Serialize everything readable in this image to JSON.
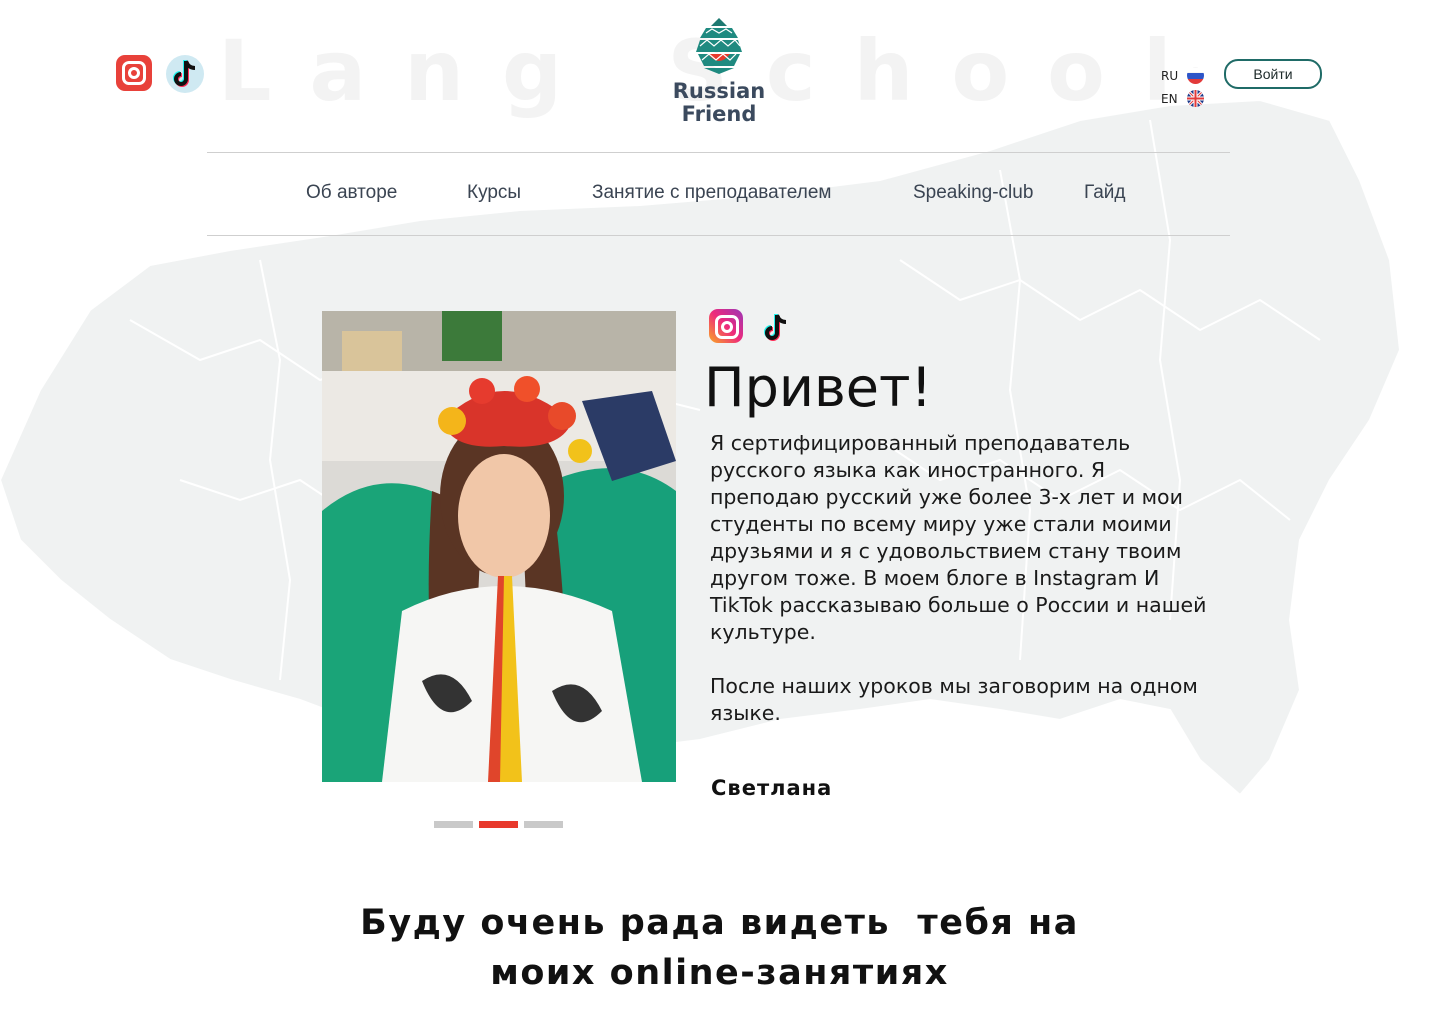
{
  "header": {
    "watermark": "Lang School",
    "logo_line1": "Russian",
    "logo_line2": "Friend",
    "languages": [
      {
        "code": "RU",
        "flag": "russia-flag-icon"
      },
      {
        "code": "EN",
        "flag": "uk-flag-icon"
      }
    ],
    "login_label": "Войти",
    "social": [
      "instagram-icon",
      "tiktok-icon"
    ]
  },
  "nav": {
    "items": [
      {
        "label": "Об авторе"
      },
      {
        "label": "Курсы"
      },
      {
        "label": "Занятие с преподавателем"
      },
      {
        "label": "Speaking-club"
      },
      {
        "label": "Гайд"
      }
    ]
  },
  "hero": {
    "greeting": "Привет!",
    "bio_paragraph1": "Я сертифицированный преподаватель русского языка как иностранного. Я преподаю русский уже более 3-х лет и мои студенты по всему миру уже стали моими друзьями и я с удовольствием стану твоим другом тоже. В моем блоге в Instagram И TikTok рассказываю больше о России и нашей культуре.",
    "bio_paragraph2": "После наших уроков мы заговорим на одном языке.",
    "signature": "Светлана",
    "carousel": {
      "count": 3,
      "active_index": 1
    }
  },
  "cta": {
    "line1": "Буду очень рада видеть  тебя на",
    "line2": "моих online-занятиях"
  },
  "colors": {
    "accent_red": "#e8392c",
    "brand_green": "#1f6b67",
    "logo_text": "#3b4a5e",
    "nav_text": "#3a4452"
  }
}
